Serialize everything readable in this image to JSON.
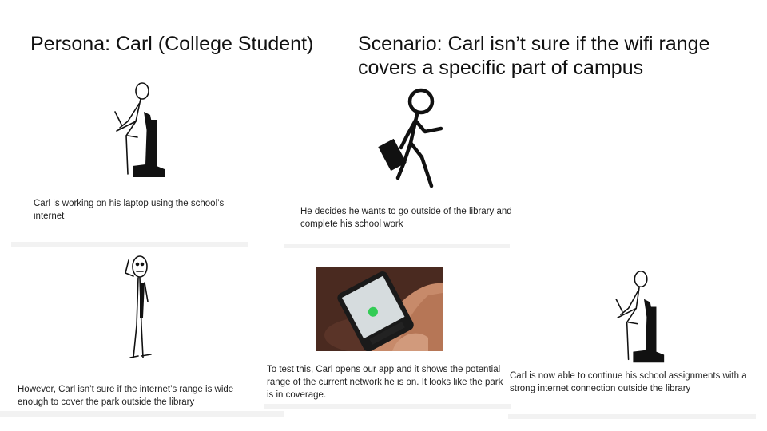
{
  "persona_title": "Persona: Carl (College Student)",
  "scenario_title": "Scenario: Carl isn’t sure if the wifi range covers a specific part of campus",
  "panels": [
    {
      "caption": "Carl is working on his laptop using the school’s internet"
    },
    {
      "caption": "He decides he wants to go outside of the library and complete his school work"
    },
    {
      "caption": "However, Carl isn’t sure if the internet’s range is wide enough to cover the park outside the library"
    },
    {
      "caption": "To test this, Carl opens our app and it shows the potential range of the current network he is on. It looks like the park is in coverage."
    },
    {
      "caption": "Carl is now able to continue his school assignments with a strong internet connection outside the library"
    }
  ],
  "icons": [
    "person-at-laptop-icon",
    "person-walking-icon",
    "person-thinking-icon",
    "phone-photo",
    "person-at-laptop-icon"
  ]
}
